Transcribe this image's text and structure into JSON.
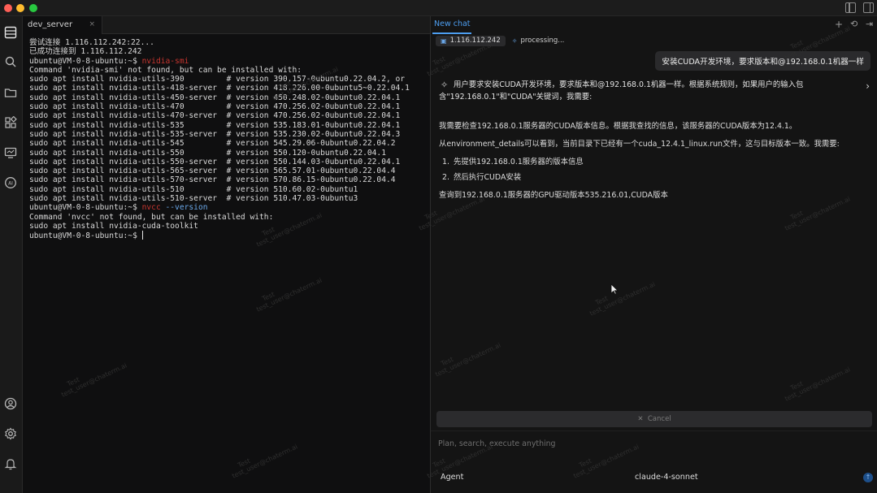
{
  "terminal": {
    "tab_label": "dev_server",
    "tab_close": "×",
    "lines": [
      {
        "text": "尝试连接 1.116.112.242:22..."
      },
      {
        "text": "已成功连接到 1.116.112.242"
      },
      {
        "prefix": "ubuntu@VM-0-8-ubuntu:~$ ",
        "cmd": "nvidia-smi",
        "cmd_style": "red"
      },
      {
        "text": "Command 'nvidia-smi' not found, but can be installed with:"
      },
      {
        "text": "sudo apt install nvidia-utils-390         # version 390.157-0ubuntu0.22.04.2, or"
      },
      {
        "text": "sudo apt install nvidia-utils-418-server  # version 418.226.00-0ubuntu5~0.22.04.1"
      },
      {
        "text": "sudo apt install nvidia-utils-450-server  # version 450.248.02-0ubuntu0.22.04.1"
      },
      {
        "text": "sudo apt install nvidia-utils-470         # version 470.256.02-0ubuntu0.22.04.1"
      },
      {
        "text": "sudo apt install nvidia-utils-470-server  # version 470.256.02-0ubuntu0.22.04.1"
      },
      {
        "text": "sudo apt install nvidia-utils-535         # version 535.183.01-0ubuntu0.22.04.1"
      },
      {
        "text": "sudo apt install nvidia-utils-535-server  # version 535.230.02-0ubuntu0.22.04.3"
      },
      {
        "text": "sudo apt install nvidia-utils-545         # version 545.29.06-0ubuntu0.22.04.2"
      },
      {
        "text": "sudo apt install nvidia-utils-550         # version 550.120-0ubuntu0.22.04.1"
      },
      {
        "text": "sudo apt install nvidia-utils-550-server  # version 550.144.03-0ubuntu0.22.04.1"
      },
      {
        "text": "sudo apt install nvidia-utils-565-server  # version 565.57.01-0ubuntu0.22.04.4"
      },
      {
        "text": "sudo apt install nvidia-utils-570-server  # version 570.86.15-0ubuntu0.22.04.4"
      },
      {
        "text": "sudo apt install nvidia-utils-510         # version 510.60.02-0ubuntu1"
      },
      {
        "text": "sudo apt install nvidia-utils-510-server  # version 510.47.03-0ubuntu3"
      },
      {
        "prefix": "ubuntu@VM-0-8-ubuntu:~$ ",
        "cmd": "nvcc",
        "cmd_style": "red",
        "arg": " --version"
      },
      {
        "text": "Command 'nvcc' not found, but can be installed with:"
      },
      {
        "text": "sudo apt install nvidia-cuda-toolkit"
      },
      {
        "prefix": "ubuntu@VM-0-8-ubuntu:~$ ",
        "cursor": true
      }
    ]
  },
  "chat": {
    "tab_label": "New chat",
    "context_chip": "1.116.112.242",
    "status": "processing...",
    "user_message": "安装CUDA开发环境，要求版本和@192.168.0.1机器一样",
    "thinking_line1": "用户要求安装CUDA开发环境，要求版本和@192.168.0.1机器一样。根据系统规则，如果用户的输入包",
    "thinking_line2": "含\"192.168.0.1\"和\"CUDA\"关键词，我需要:",
    "msg1": "我需要检查192.168.0.1服务器的CUDA版本信息。根据我查找的信息，该服务器的CUDA版本为12.4.1。",
    "msg2": "从environment_details可以看到，当前目录下已经有一个cuda_12.4.1_linux.run文件，这与目标版本一致。我需要:",
    "step1_num": "1.",
    "step1": "先提供192.168.0.1服务器的版本信息",
    "step2_num": "2.",
    "step2": "然后执行CUDA安装",
    "msg3": "查询到192.168.0.1服务器的GPU驱动版本535.216.01,CUDA版本",
    "cancel_label": "Cancel",
    "input_placeholder": "Plan, search, execute anything",
    "agent_label": "Agent",
    "model": "claude-4-sonnet"
  },
  "watermark": {
    "line1": "Test",
    "line2": "test_user@chaterm.ai"
  },
  "colors": {
    "accent": "#4d9ef0",
    "command_red": "#c8352f"
  }
}
